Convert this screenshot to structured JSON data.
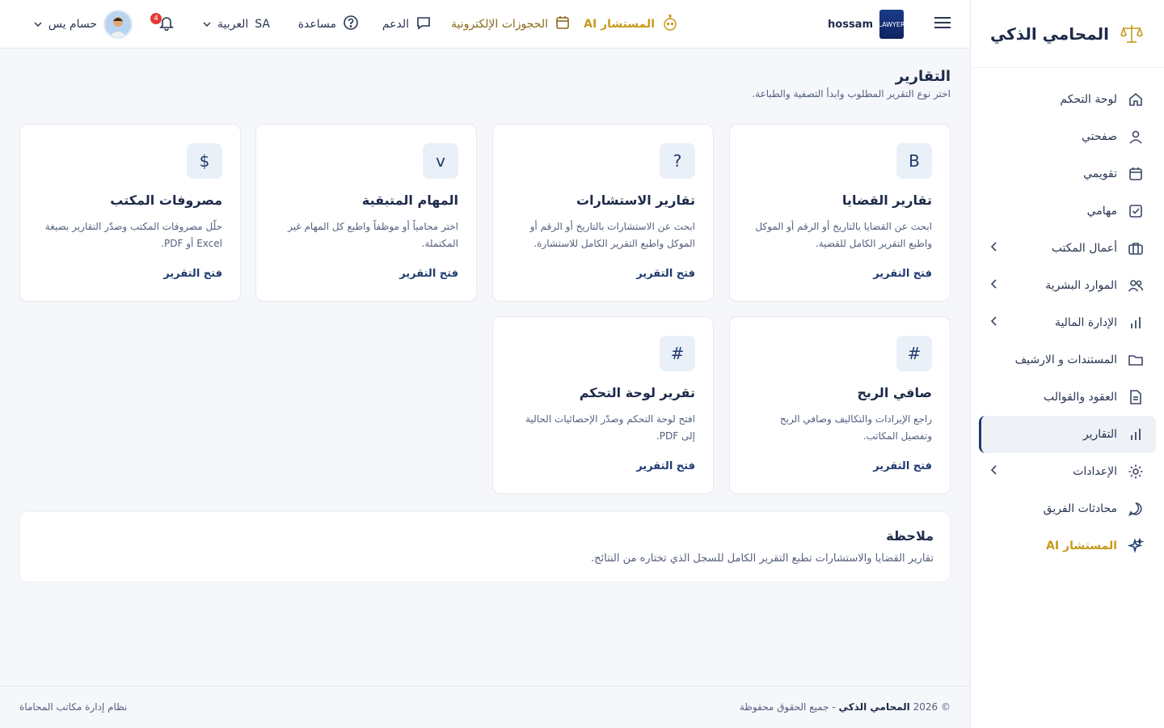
{
  "colors": {
    "accent": "#1e3a6e",
    "gold": "#c79a1a",
    "badge": "#e53935"
  },
  "sidebar": {
    "brand": "المحامي الذكي",
    "items": [
      {
        "label": "لوحة التحكم",
        "icon": "home-icon"
      },
      {
        "label": "صفحتي",
        "icon": "user-icon"
      },
      {
        "label": "تقويمي",
        "icon": "calendar-icon"
      },
      {
        "label": "مهامي",
        "icon": "checkbox-icon"
      },
      {
        "label": "أعمال المكتب",
        "icon": "briefcase-icon",
        "has_children": true
      },
      {
        "label": "الموارد البشرية",
        "icon": "users-icon",
        "has_children": true
      },
      {
        "label": "الإدارة المالية",
        "icon": "bar-chart-icon",
        "has_children": true
      },
      {
        "label": "المستندات و الارشيف",
        "icon": "folder-icon"
      },
      {
        "label": "العقود والقوالب",
        "icon": "document-icon"
      },
      {
        "label": "التقارير",
        "icon": "bar-chart-icon",
        "active": true
      },
      {
        "label": "الإعدادات",
        "icon": "gear-icon",
        "has_children": true
      },
      {
        "label": "محادثات الفريق",
        "icon": "chat-icon"
      },
      {
        "label": "المستشار AI",
        "icon": "sparkle-icon"
      }
    ]
  },
  "topbar": {
    "username": "hossam",
    "logo_text": "LAWYER",
    "ai_label": "المستشار AI",
    "bookings_label": "الحجوزات الإلكترونية",
    "support_label": "الدعم",
    "help_label": "مساعدة",
    "lang_code": "SA",
    "lang_label": "العربية",
    "notifications_count": "4",
    "user_name": "حسام يس"
  },
  "page": {
    "title": "التقارير",
    "subtitle": "اختر نوع التقرير المطلوب وابدأ التصفية والطباعة."
  },
  "cards": [
    {
      "icon": "B",
      "title": "تقارير القضايا",
      "desc": "ابحث عن القضايا بالتاريخ أو الرقم أو الموكل واطبع التقرير الكامل للقضية.",
      "link": "فتح التقرير"
    },
    {
      "icon": "?",
      "title": "تقارير الاستشارات",
      "desc": "ابحث عن الاستشارات بالتاريخ أو الرقم أو الموكل واطبع التقرير الكامل للاستشارة.",
      "link": "فتح التقرير"
    },
    {
      "icon": "v",
      "title": "المهام المتبقية",
      "desc": "اختر محامياً أو موظفاً واطبع كل المهام غير المكتملة.",
      "link": "فتح التقرير"
    },
    {
      "icon": "$",
      "title": "مصروفات المكتب",
      "desc": "حلّل مصروفات المكتب وصدّر التقارير بصيغة Excel أو PDF.",
      "link": "فتح التقرير"
    },
    {
      "icon": "#",
      "title": "صافي الربح",
      "desc": "راجع الإيرادات والتكاليف وصافي الربح وتفصيل المكاتب.",
      "link": "فتح التقرير"
    },
    {
      "icon": "#",
      "title": "تقرير لوحة التحكم",
      "desc": "افتح لوحة التحكم وصدّر الإحصائيات الحالية إلى PDF.",
      "link": "فتح التقرير"
    }
  ],
  "note": {
    "title": "ملاحظة",
    "text": "تقارير القضايا والاستشارات تطبع التقرير الكامل للسجل الذي تختاره من النتائج."
  },
  "footer": {
    "copyright_prefix": "© 2026",
    "brand": "المحامي الذكي",
    "rights": "- جميع الحقوق محفوظة",
    "system": "نظام إدارة مكاتب المحاماة"
  }
}
